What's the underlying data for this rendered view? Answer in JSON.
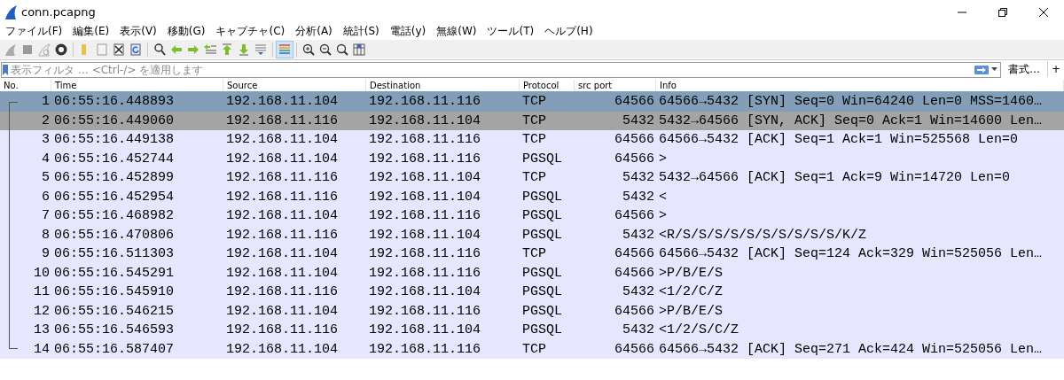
{
  "window": {
    "title": "conn.pcapng"
  },
  "menu": [
    "ファイル(F)",
    "編集(E)",
    "表示(V)",
    "移動(G)",
    "キャプチャ(C)",
    "分析(A)",
    "統計(S)",
    "電話(y)",
    "無線(W)",
    "ツール(T)",
    "ヘルプ(H)"
  ],
  "filter": {
    "placeholder": "表示フィルタ … <Ctrl-/> を適用します",
    "format_button": "書式…",
    "add_button": "+"
  },
  "table": {
    "columns": [
      "No.",
      "Time",
      "Source",
      "Destination",
      "Protocol",
      "src port",
      "Info"
    ],
    "rows": [
      {
        "cells": [
          "1",
          "06:55:16.448893",
          "192.168.11.104",
          "192.168.11.116",
          "TCP",
          "64566",
          "64566→5432 [SYN] Seq=0 Win=64240 Len=0 MSS=1460…"
        ],
        "selected": true,
        "hovered": false,
        "conversation_start": true,
        "conversation_end": false
      },
      {
        "cells": [
          "2",
          "06:55:16.449060",
          "192.168.11.116",
          "192.168.11.104",
          "TCP",
          "5432",
          "5432→64566 [SYN, ACK] Seq=0 Ack=1 Win=14600 Len…"
        ],
        "selected": false,
        "hovered": true,
        "conversation_start": false,
        "conversation_end": false
      },
      {
        "cells": [
          "3",
          "06:55:16.449138",
          "192.168.11.104",
          "192.168.11.116",
          "TCP",
          "64566",
          "64566→5432 [ACK] Seq=1 Ack=1 Win=525568 Len=0"
        ],
        "selected": false,
        "hovered": false,
        "conversation_start": false,
        "conversation_end": false
      },
      {
        "cells": [
          "4",
          "06:55:16.452744",
          "192.168.11.104",
          "192.168.11.116",
          "PGSQL",
          "64566",
          ">"
        ],
        "selected": false,
        "hovered": false,
        "conversation_start": false,
        "conversation_end": false
      },
      {
        "cells": [
          "5",
          "06:55:16.452899",
          "192.168.11.116",
          "192.168.11.104",
          "TCP",
          "5432",
          "5432→64566 [ACK] Seq=1 Ack=9 Win=14720 Len=0"
        ],
        "selected": false,
        "hovered": false,
        "conversation_start": false,
        "conversation_end": false
      },
      {
        "cells": [
          "6",
          "06:55:16.452954",
          "192.168.11.116",
          "192.168.11.104",
          "PGSQL",
          "5432",
          "<"
        ],
        "selected": false,
        "hovered": false,
        "conversation_start": false,
        "conversation_end": false
      },
      {
        "cells": [
          "7",
          "06:55:16.468982",
          "192.168.11.104",
          "192.168.11.116",
          "PGSQL",
          "64566",
          ">"
        ],
        "selected": false,
        "hovered": false,
        "conversation_start": false,
        "conversation_end": false
      },
      {
        "cells": [
          "8",
          "06:55:16.470806",
          "192.168.11.116",
          "192.168.11.104",
          "PGSQL",
          "5432",
          "<R/S/S/S/S/S/S/S/S/S/S/K/Z"
        ],
        "selected": false,
        "hovered": false,
        "conversation_start": false,
        "conversation_end": false
      },
      {
        "cells": [
          "9",
          "06:55:16.511303",
          "192.168.11.104",
          "192.168.11.116",
          "TCP",
          "64566",
          "64566→5432 [ACK] Seq=124 Ack=329 Win=525056 Len…"
        ],
        "selected": false,
        "hovered": false,
        "conversation_start": false,
        "conversation_end": false
      },
      {
        "cells": [
          "10",
          "06:55:16.545291",
          "192.168.11.104",
          "192.168.11.116",
          "PGSQL",
          "64566",
          ">P/B/E/S"
        ],
        "selected": false,
        "hovered": false,
        "conversation_start": false,
        "conversation_end": false
      },
      {
        "cells": [
          "11",
          "06:55:16.545910",
          "192.168.11.116",
          "192.168.11.104",
          "PGSQL",
          "5432",
          "<1/2/C/Z"
        ],
        "selected": false,
        "hovered": false,
        "conversation_start": false,
        "conversation_end": false
      },
      {
        "cells": [
          "12",
          "06:55:16.546215",
          "192.168.11.104",
          "192.168.11.116",
          "PGSQL",
          "64566",
          ">P/B/E/S"
        ],
        "selected": false,
        "hovered": false,
        "conversation_start": false,
        "conversation_end": false
      },
      {
        "cells": [
          "13",
          "06:55:16.546593",
          "192.168.11.116",
          "192.168.11.104",
          "PGSQL",
          "5432",
          "<1/2/S/C/Z"
        ],
        "selected": false,
        "hovered": false,
        "conversation_start": false,
        "conversation_end": false
      },
      {
        "cells": [
          "14",
          "06:55:16.587407",
          "192.168.11.104",
          "192.168.11.116",
          "TCP",
          "64566",
          "64566→5432 [ACK] Seq=271 Ack=424 Win=525056 Len…"
        ],
        "selected": false,
        "hovered": false,
        "conversation_start": false,
        "conversation_end": true
      }
    ]
  }
}
